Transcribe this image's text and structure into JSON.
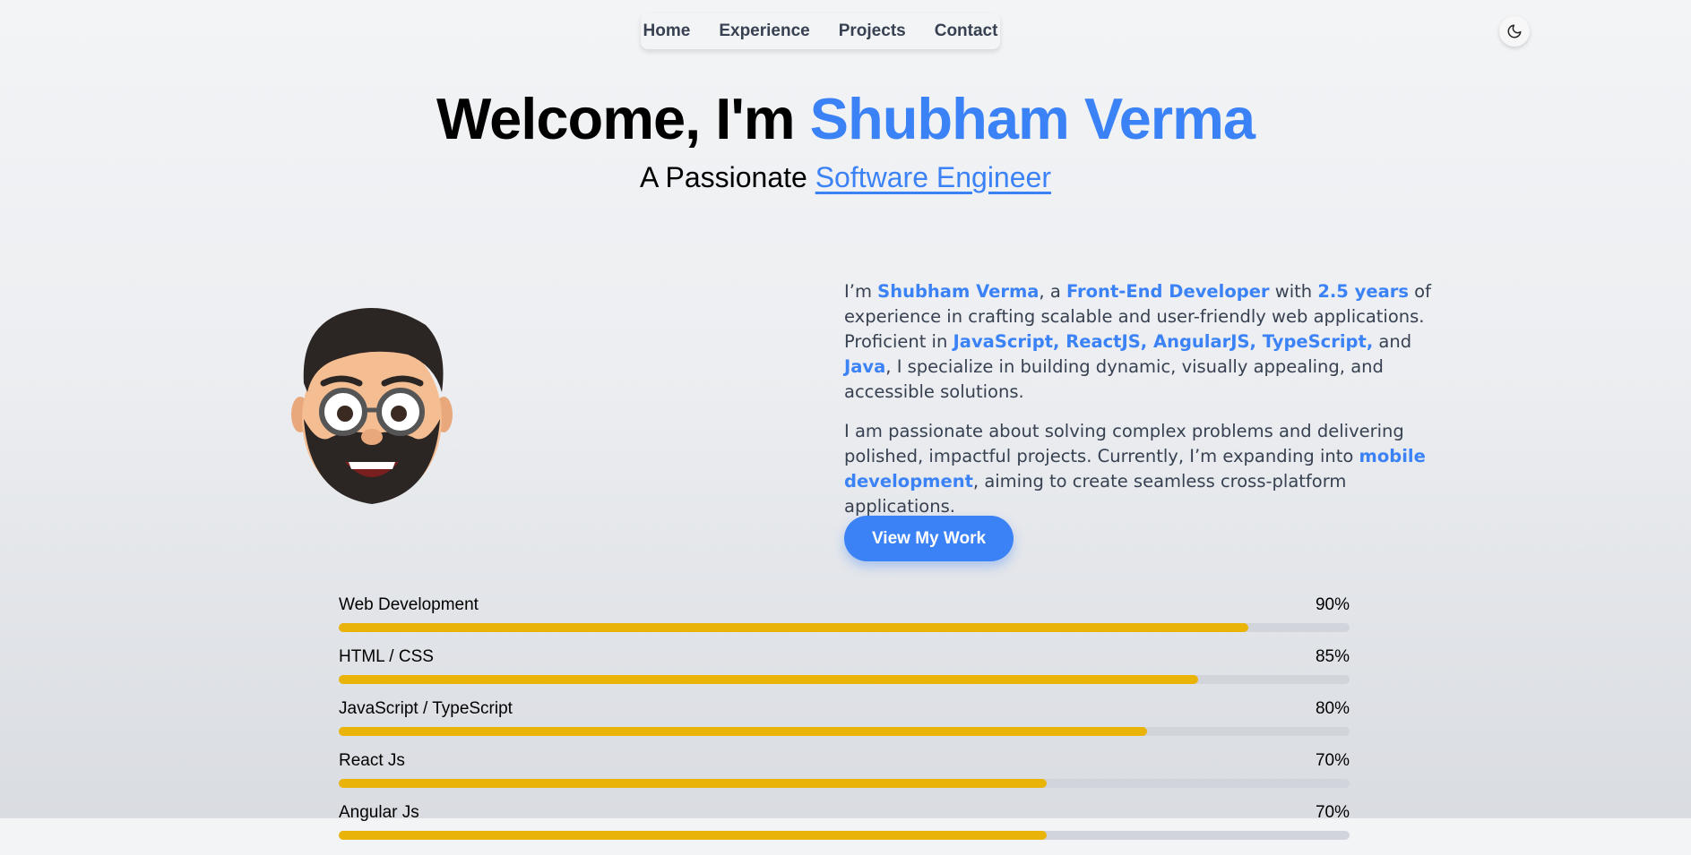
{
  "nav": {
    "items": [
      "Home",
      "Experience",
      "Projects",
      "Contact"
    ]
  },
  "theme_toggle_icon": "moon-icon",
  "hero": {
    "prefix": "Welcome, I'm ",
    "name": "Shubham Verma",
    "subtitle_prefix": "A Passionate ",
    "subtitle_role": "Software Engineer"
  },
  "about": {
    "p1": [
      {
        "t": "I’m ",
        "hl": false
      },
      {
        "t": "Shubham Verma",
        "hl": true
      },
      {
        "t": ", a ",
        "hl": false
      },
      {
        "t": "Front-End Developer",
        "hl": true
      },
      {
        "t": " with ",
        "hl": false
      },
      {
        "t": "2.5 years",
        "hl": true
      },
      {
        "t": " of experience in crafting scalable and user-friendly web applications. Proficient in ",
        "hl": false
      },
      {
        "t": "JavaScript, ReactJS, AngularJS, TypeScript,",
        "hl": true
      },
      {
        "t": " and ",
        "hl": false
      },
      {
        "t": "Java",
        "hl": true
      },
      {
        "t": ", I specialize in building dynamic, visually appealing, and accessible solutions.",
        "hl": false
      }
    ],
    "p2": [
      {
        "t": "I am passionate about solving complex problems and delivering polished, impactful projects. Currently, I’m expanding into ",
        "hl": false
      },
      {
        "t": "mobile development",
        "hl": true
      },
      {
        "t": ", aiming to create seamless cross-platform applications.",
        "hl": false
      }
    ]
  },
  "cta_label": "View My Work",
  "skills": [
    {
      "name": "Web Development",
      "percent": 90,
      "label": "90%"
    },
    {
      "name": "HTML / CSS",
      "percent": 85,
      "label": "85%"
    },
    {
      "name": "JavaScript / TypeScript",
      "percent": 80,
      "label": "80%"
    },
    {
      "name": "React Js",
      "percent": 70,
      "label": "70%"
    },
    {
      "name": "Angular Js",
      "percent": 70,
      "label": "70%"
    }
  ],
  "colors": {
    "accent": "#3b82f6",
    "bar_fill": "#eab308",
    "bar_track": "#d1d5db"
  }
}
